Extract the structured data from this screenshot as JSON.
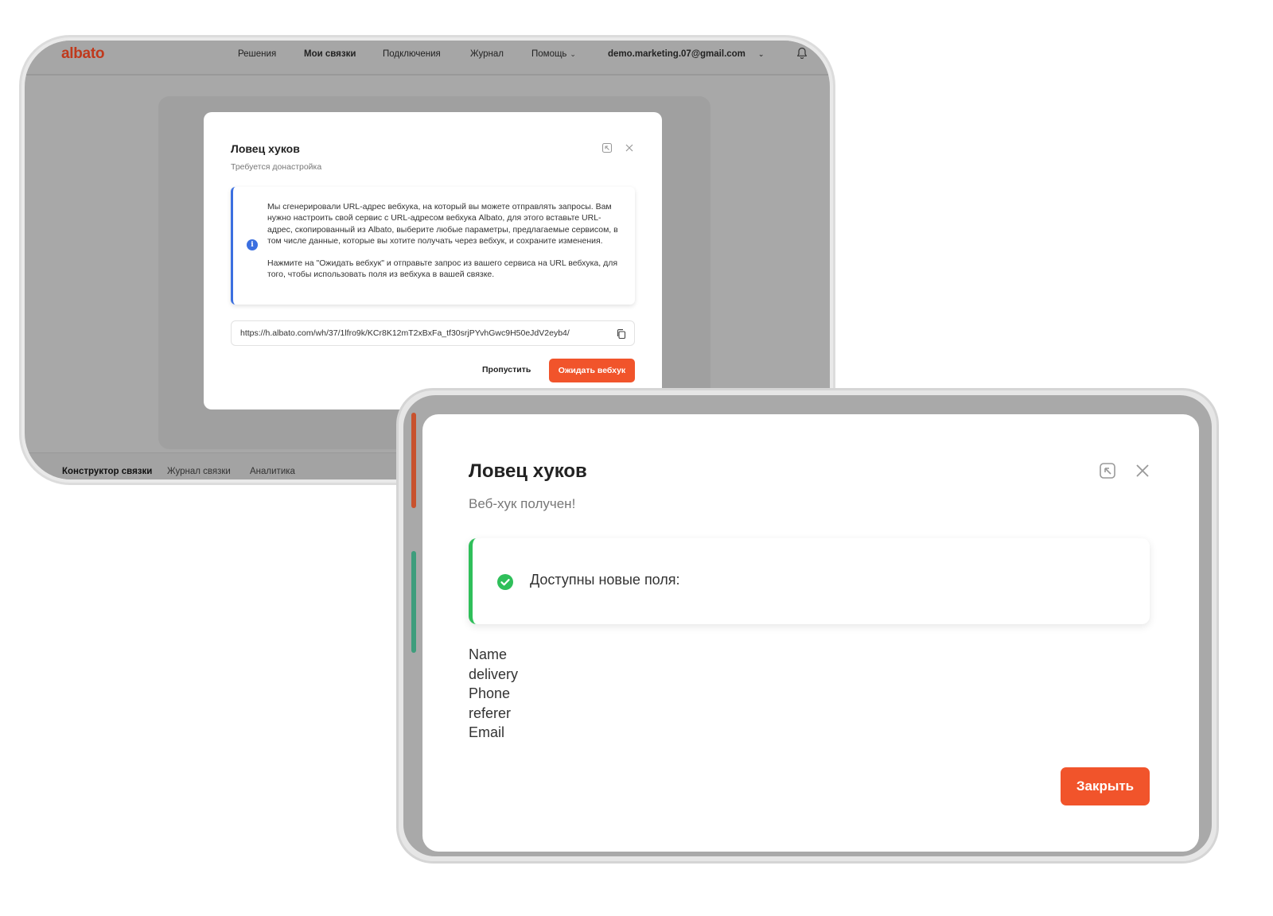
{
  "back_window": {
    "brand": "albato",
    "nav": {
      "items": [
        "Решения",
        "Мои связки",
        "Подключения",
        "Журнал",
        "Помощь"
      ],
      "account": "demo.marketing.07@gmail.com"
    },
    "bottom_tabs": [
      "Конструктор связки",
      "Журнал связки",
      "Аналитика"
    ],
    "modal": {
      "title": "Ловец хуков",
      "subtitle": "Требуется донастройка",
      "info_paragraph_1": "Мы сгенерировали URL-адрес вебхука, на который вы можете отправлять запросы. Вам нужно настроить свой сервис с URL-адресом вебхука Albato, для этого вставьте URL-адрес, скопированный из Albato, выберите любые параметры, предлагаемые сервисом, в том числе данные, которые вы хотите получать через вебхук, и сохраните изменения.",
      "info_paragraph_2": "Нажмите на \"Ожидать вебхук\" и отправьте запрос из вашего сервиса на URL вебхука, для того, чтобы использовать поля из вебхука в вашей связке.",
      "webhook_url": "https://h.albato.com/wh/37/1lfro9k/KCr8K12mT2xBxFa_tf30srjPYvhGwc9H50eJdV2eyb4/",
      "skip_label": "Пропустить",
      "wait_label": "Ожидать вебхук"
    }
  },
  "front_window": {
    "modal": {
      "title": "Ловец хуков",
      "subtitle": "Веб-хук получен!",
      "success_text": "Доступны новые поля:",
      "fields": [
        "Name",
        "delivery",
        "Phone",
        "referer",
        "Email"
      ],
      "close_label": "Закрыть"
    }
  },
  "colors": {
    "accent_orange": "#f1542b",
    "brand_red": "#c0391c",
    "info_blue": "#3b6fe0",
    "success_green": "#2fbf5a"
  },
  "icons": [
    "bell-icon",
    "chevron-down-icon",
    "collapse-icon",
    "close-icon",
    "info-icon",
    "copy-icon",
    "check-circle-icon"
  ]
}
